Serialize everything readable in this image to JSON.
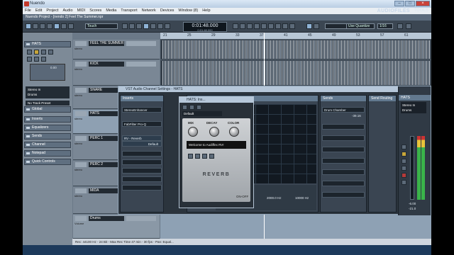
{
  "window": {
    "title": "Nuendo",
    "controls": [
      "–",
      "□",
      "×"
    ]
  },
  "menu": [
    "File",
    "Edit",
    "Project",
    "Audio",
    "MIDI",
    "Scores",
    "Media",
    "Transport",
    "Network",
    "Devices",
    "Window (8)",
    "Help"
  ],
  "brand": {
    "logo": "AUDIOFILES",
    "logo_suffix": "TOOLS"
  },
  "project_title": "Nuendo Project - [nendo 2] Feel The Summer.npr",
  "toolbar": {
    "mode": "Touch",
    "time": "0:01:48.000",
    "time_sub": "0:01:48.000",
    "quantize_mode": "Use Quantize",
    "quantize": "1/16"
  },
  "inspector": {
    "track_name": "HATS",
    "value": "0.00",
    "routing": [
      "Stereo In",
      "Drums"
    ],
    "preset": "No Track Preset",
    "sections": [
      "Global",
      "Inserts",
      "Equalizers",
      "Sends",
      "Channel",
      "Notepad",
      "Quick Controls"
    ]
  },
  "tracks": [
    {
      "name": "FEEL THE SUMMER",
      "type": "stereo"
    },
    {
      "name": "KICK",
      "type": "stereo"
    },
    {
      "name": "SNARE",
      "type": "stereo"
    },
    {
      "name": "HATS",
      "type": "stereo"
    },
    {
      "name": "PERC 1",
      "type": "stereo"
    },
    {
      "name": "PERC 2",
      "type": "stereo"
    },
    {
      "name": "MIDA",
      "type": "stereo"
    },
    {
      "name": "Drums",
      "type": "Volume"
    }
  ],
  "ruler": [
    "21",
    "25",
    "29",
    "33",
    "37",
    "41",
    "45",
    "49",
    "53",
    "57",
    "61"
  ],
  "vst_window": {
    "title": "VST Audio Channel Settings - HATS",
    "inserts_title": "Inserts",
    "inserts": [
      "StereoEnhancer",
      "FabFilter Pro-Q",
      "RV - Reverb"
    ],
    "insert_preset": "Default",
    "eq_title": "Equalizer",
    "eq_values": [
      "2000.0 Hz",
      "10000 Hz"
    ],
    "sends_title": "Sends",
    "send_slot": "Drum Chamber",
    "send_value": "-39.16",
    "send_routing_title": "Send Routing",
    "channel_name": "HATS",
    "channel_routing": [
      "Stereo In",
      "Drums"
    ],
    "fader_value": "-6.00",
    "fader_value2": "-21.0"
  },
  "plugin": {
    "title": "HATS: Ins...",
    "preset": "Default",
    "labels": [
      "MIX",
      "DECAY",
      "COLOR"
    ],
    "lcd": "Welcome to Audiffex RV!",
    "brand": "REVERB",
    "badge": "ON-OFF"
  },
  "status": "Rec: 44100 Hz - 24 Bit - Max Rec Time 47 min - 30 fps - Pan: Equal..."
}
